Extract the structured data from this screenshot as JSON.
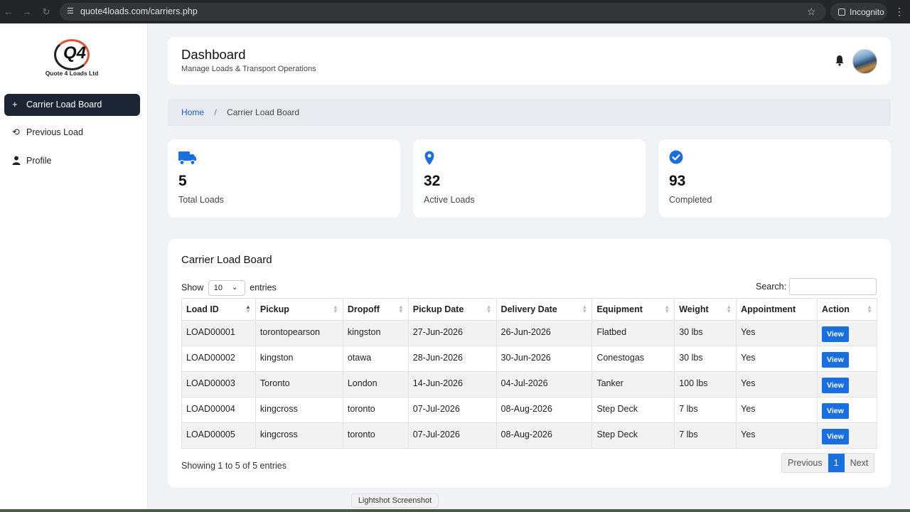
{
  "browser": {
    "url": "quote4loads.com/carriers.php",
    "incognito_label": "Incognito"
  },
  "sidebar": {
    "logo_text": "Quote 4 Loads Ltd",
    "items": [
      {
        "label": "Carrier Load Board",
        "icon": "plus-icon",
        "active": true
      },
      {
        "label": "Previous Load",
        "icon": "history-icon",
        "active": false
      },
      {
        "label": "Profile",
        "icon": "user-icon",
        "active": false
      }
    ]
  },
  "header": {
    "title": "Dashboard",
    "subtitle": "Manage Loads & Transport Operations"
  },
  "breadcrumb": {
    "home": "Home",
    "separator": "/",
    "current": "Carrier Load Board"
  },
  "stats": [
    {
      "icon": "truck-icon",
      "value": "5",
      "label": "Total Loads"
    },
    {
      "icon": "map-pin-icon",
      "value": "32",
      "label": "Active Loads"
    },
    {
      "icon": "check-circle-icon",
      "value": "93",
      "label": "Completed"
    }
  ],
  "board": {
    "title": "Carrier Load Board",
    "show_label": "Show",
    "entries_value": "10",
    "entries_label": "entries",
    "search_label": "Search:",
    "columns": [
      "Load ID",
      "Pickup",
      "Dropoff",
      "Pickup Date",
      "Delivery Date",
      "Equipment",
      "Weight",
      "Appointment",
      "Action"
    ],
    "rows": [
      [
        "LOAD00001",
        "torontopearson",
        "kingston",
        "27-Jun-2026",
        "26-Jun-2026",
        "Flatbed",
        "30 lbs",
        "Yes",
        "View"
      ],
      [
        "LOAD00002",
        "kingston",
        "otawa",
        "28-Jun-2026",
        "30-Jun-2026",
        "Conestogas",
        "30 lbs",
        "Yes",
        "View"
      ],
      [
        "LOAD00003",
        "Toronto",
        "London",
        "14-Jun-2026",
        "04-Jul-2026",
        "Tanker",
        "100 lbs",
        "Yes",
        "View"
      ],
      [
        "LOAD00004",
        "kingcross",
        "toronto",
        "07-Jul-2026",
        "08-Aug-2026",
        "Step Deck",
        "7 lbs",
        "Yes",
        "View"
      ],
      [
        "LOAD00005",
        "kingcross",
        "toronto",
        "07-Jul-2026",
        "08-Aug-2026",
        "Step Deck",
        "7 lbs",
        "Yes",
        "View"
      ]
    ],
    "info": "Showing 1 to 5 of 5 entries",
    "pager": {
      "previous": "Previous",
      "current": "1",
      "next": "Next"
    }
  },
  "tooltip": "Lightshot Screenshot",
  "colors": {
    "accent": "#1a6fe0",
    "sidebar_active": "#1d2535"
  }
}
